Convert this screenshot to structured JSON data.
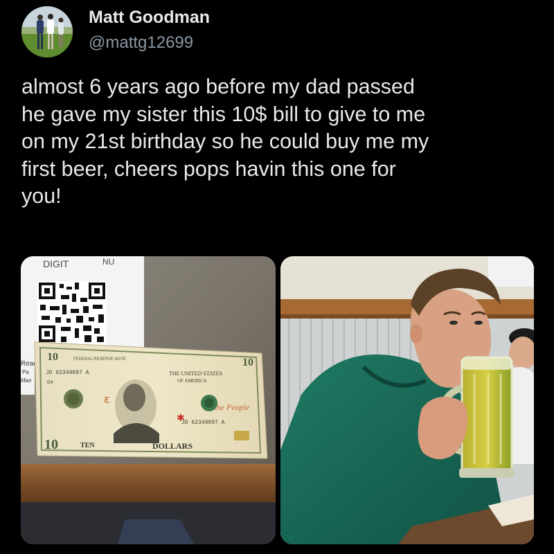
{
  "author": {
    "display_name": "Matt Goodman",
    "handle": "@mattg12699",
    "avatar_icon": "profile-photo"
  },
  "tweet": {
    "text": "almost 6 years ago before my dad passed\nhe gave my sister this 10$ bill to give to me\non my 21st birthday so he could buy me my\nfirst beer, cheers pops havin this one for\nyou!"
  },
  "media": {
    "left": {
      "sign_text": "DIGIT",
      "sign_text_2": "NU",
      "bill_serial": "JD 62349097 A",
      "bill_plate": "D4",
      "bill_header": "FEDERAL RESERVE NOTE",
      "bill_country_1": "THE UNITED STATES",
      "bill_country_2": "OF AMERICA",
      "bill_denomination_number": "10",
      "bill_word_ten": "TEN",
      "bill_word_dollars": "DOLLARS",
      "bill_we_the_people": "We the People",
      "side_text_1": "Read",
      "side_text_2": "Pa",
      "side_text_3": "Man"
    },
    "right": {
      "description_icon": "photo-beer-mug"
    }
  }
}
